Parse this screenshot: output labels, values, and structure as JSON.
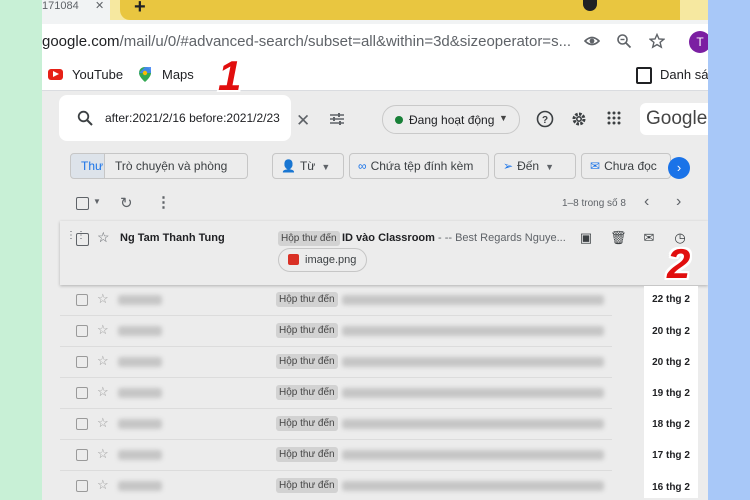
{
  "browser": {
    "tab_title": "171084",
    "tab_close": "✕",
    "new_tab": "+",
    "url_host": "google.com",
    "url_rest": "/mail/u/0/#advanced-search/subset=all&within=3d&sizeoperator=s...",
    "avatar_letter": "T"
  },
  "bookmarks": {
    "youtube": "YouTube",
    "maps": "Maps",
    "right_folder": "Danh sác"
  },
  "gmail": {
    "search_query": "after:2021/2/16 before:2021/2/23",
    "status": "Đang hoạt động",
    "logo": "Google",
    "chips": [
      {
        "label": "Thư"
      },
      {
        "label": "Trò chuyện và phòng"
      },
      {
        "label": "Từ"
      },
      {
        "label": "Chứa tệp đính kèm"
      },
      {
        "label": "Đến"
      },
      {
        "label": "Chưa đọc"
      }
    ],
    "paging": "1–8 trong số 8",
    "inbox_label": "Hộp thư đến",
    "main_row": {
      "sender": "Ng Tam Thanh Tung",
      "subject": "ID vào Classroom",
      "snippet": " - -- Best Regards Nguye...",
      "attachment": "image.png"
    },
    "dates": [
      "22 thg 2",
      "20 thg 2",
      "20 thg 2",
      "19 thg 2",
      "18 thg 2",
      "17 thg 2",
      "16 thg 2"
    ]
  },
  "annotations": {
    "marker_1": "1",
    "marker_2": "2"
  },
  "colors": {
    "accent_blue": "#1a73e8",
    "marker_red": "#e10e0e",
    "active_green": "#188038"
  }
}
